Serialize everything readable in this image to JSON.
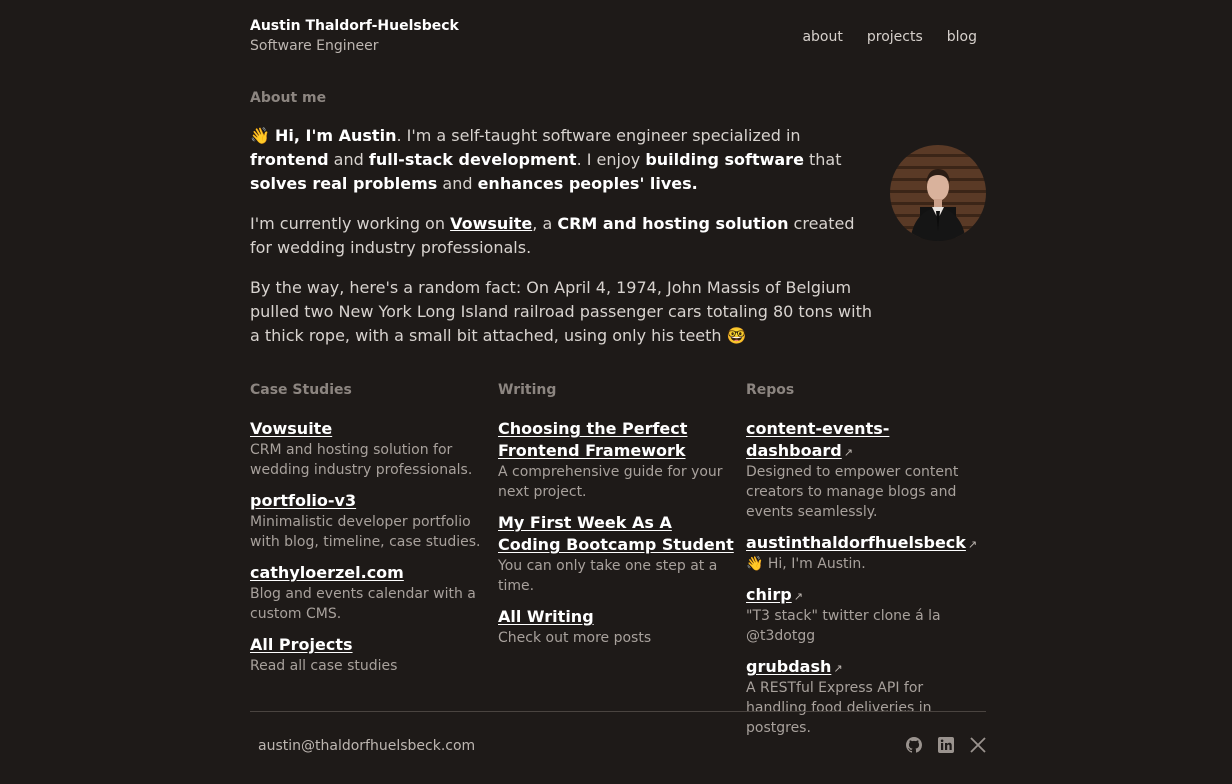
{
  "header": {
    "name": "Austin Thaldorf-Huelsbeck",
    "role": "Software Engineer",
    "nav": [
      "about",
      "projects",
      "blog"
    ]
  },
  "about": {
    "title": "About me",
    "p1": {
      "wave": "👋",
      "greeting": "Hi, I'm Austin",
      "t1": ". I'm a self-taught software engineer specialized in ",
      "b1": "frontend",
      "t2": " and ",
      "b2": "full-stack development",
      "t3": ". I enjoy ",
      "b3": "building software",
      "t4": " that ",
      "b4": "solves real problems",
      "t5": " and ",
      "b5": "enhances peoples' lives."
    },
    "p2": {
      "t1": "I'm currently working on ",
      "link": "Vowsuite",
      "t2": ", a ",
      "b1": "CRM and hosting solution",
      "t3": " created for wedding industry professionals."
    },
    "p3": {
      "text": "By the way, here's a random fact: On April 4, 1974, John Massis of Belgium pulled two New York Long Island railroad passenger cars totaling 80 tons with a thick rope, with a small bit attached, using only his teeth ",
      "emoji": "🤓"
    }
  },
  "case_studies": {
    "title": "Case Studies",
    "items": [
      {
        "label": "Vowsuite",
        "desc": "CRM and hosting solution for wedding industry professionals."
      },
      {
        "label": "portfolio-v3",
        "desc": "Minimalistic developer portfolio with blog, timeline, case studies."
      },
      {
        "label": "cathyloerzel.com",
        "desc": "Blog and events calendar with a custom CMS."
      },
      {
        "label": "All Projects",
        "desc": "Read all case studies"
      }
    ]
  },
  "writing": {
    "title": "Writing",
    "items": [
      {
        "label": "Choosing the Perfect Frontend Framework",
        "desc": "A comprehensive guide for your next project."
      },
      {
        "label": "My First Week As A Coding Bootcamp Student",
        "desc": "You can only take one step at a time."
      },
      {
        "label": "All Writing",
        "desc": "Check out more posts"
      }
    ]
  },
  "repos": {
    "title": "Repos",
    "arrow": "↗",
    "items": [
      {
        "label": "content-events-dashboard",
        "desc": "Designed to empower content creators to manage blogs and events seamlessly."
      },
      {
        "label": "austinthaldorfhuelsbeck",
        "desc": "👋 Hi, I'm Austin."
      },
      {
        "label": "chirp",
        "desc": "\"T3 stack\" twitter clone á la @t3dotgg"
      },
      {
        "label": "grubdash",
        "desc": "A RESTful Express API for handling food deliveries in postgres."
      }
    ]
  },
  "footer": {
    "email": "austin@thaldorfhuelsbeck.com",
    "social_icons": [
      "github-icon",
      "linkedin-icon",
      "x-icon"
    ]
  }
}
